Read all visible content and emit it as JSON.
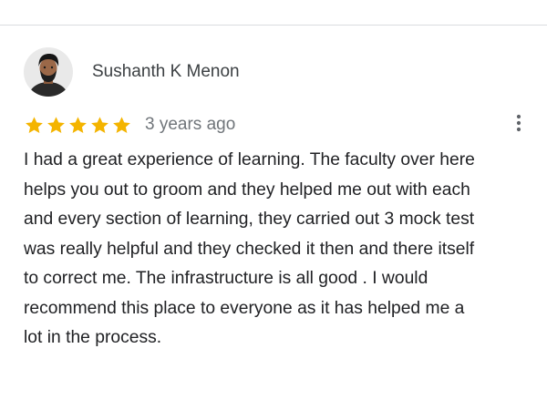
{
  "review": {
    "author": "Sushanth K Menon",
    "rating": 5,
    "rating_max": 5,
    "time_ago": "3 years ago",
    "text_lines": [
      "I had a great experience of learning. The faculty over here",
      "helps you out to groom and they helped me out with each",
      "and every section of learning, they carried out 3 mock test",
      "was really helpful and they checked it then and there itself",
      "to correct me. The infrastructure is all good . I would",
      "recommend this place to everyone as it has helped me a",
      "lot in the process."
    ]
  },
  "colors": {
    "star": "#f4b400",
    "author": "#3c4043",
    "meta": "#70757a",
    "text": "#202124",
    "divider": "#dadce0"
  },
  "icons": {
    "avatar": "profile-photo",
    "star": "star-icon",
    "more": "more-vert-icon"
  }
}
